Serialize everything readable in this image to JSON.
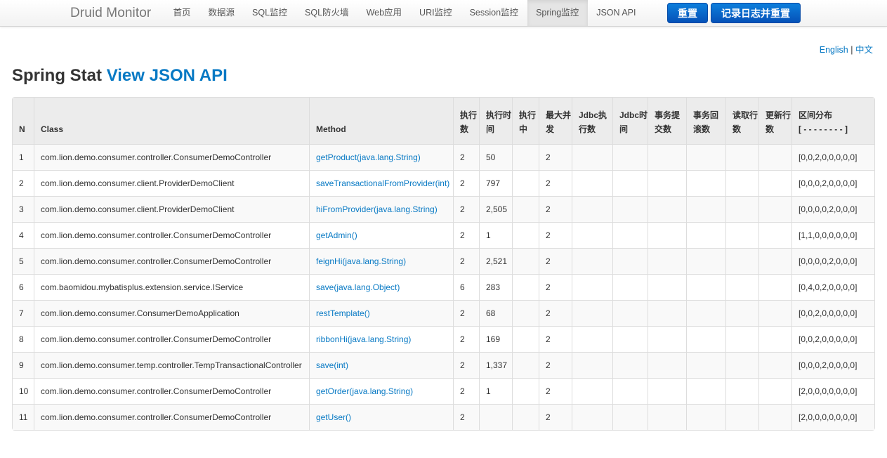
{
  "brand": "Druid Monitor",
  "nav": [
    "首页",
    "数据源",
    "SQL监控",
    "SQL防火墙",
    "Web应用",
    "URI监控",
    "Session监控",
    "Spring监控",
    "JSON API"
  ],
  "nav_active": 7,
  "buttons": {
    "reset": "重置",
    "log_reset": "记录日志并重置"
  },
  "lang": {
    "english": "English",
    "separator": "|",
    "chinese": "中文"
  },
  "title": {
    "prefix": "Spring Stat",
    "link": "View JSON API"
  },
  "table": {
    "headers": {
      "n": "N",
      "cls": "Class",
      "method": "Method",
      "exec_count": "执行数",
      "exec_time": "执行时间",
      "running": "执行中",
      "max_concurrent": "最大并发",
      "jdbc_exec": "Jdbc执行数",
      "jdbc_time": "Jdbc时间",
      "tx_commit": "事务提交数",
      "tx_rollback": "事务回滚数",
      "fetch_rows": "读取行数",
      "update_rows": "更新行数",
      "histogram": "区间分布",
      "histogram_sub": "[ - - - - - - - - ]"
    },
    "rows": [
      {
        "n": "1",
        "cls": "com.lion.demo.consumer.controller.ConsumerDemoController",
        "method": "getProduct(java.lang.String)",
        "exec_count": "2",
        "exec_time": "50",
        "running": "",
        "max_concurrent": "2",
        "jdbc_exec": "",
        "jdbc_time": "",
        "tx_commit": "",
        "tx_rollback": "",
        "fetch_rows": "",
        "update_rows": "",
        "histogram": "[0,0,2,0,0,0,0,0]"
      },
      {
        "n": "2",
        "cls": "com.lion.demo.consumer.client.ProviderDemoClient",
        "method": "saveTransactionalFromProvider(int)",
        "exec_count": "2",
        "exec_time": "797",
        "running": "",
        "max_concurrent": "2",
        "jdbc_exec": "",
        "jdbc_time": "",
        "tx_commit": "",
        "tx_rollback": "",
        "fetch_rows": "",
        "update_rows": "",
        "histogram": "[0,0,0,2,0,0,0,0]"
      },
      {
        "n": "3",
        "cls": "com.lion.demo.consumer.client.ProviderDemoClient",
        "method": "hiFromProvider(java.lang.String)",
        "exec_count": "2",
        "exec_time": "2,505",
        "running": "",
        "max_concurrent": "2",
        "jdbc_exec": "",
        "jdbc_time": "",
        "tx_commit": "",
        "tx_rollback": "",
        "fetch_rows": "",
        "update_rows": "",
        "histogram": "[0,0,0,0,2,0,0,0]"
      },
      {
        "n": "4",
        "cls": "com.lion.demo.consumer.controller.ConsumerDemoController",
        "method": "getAdmin()",
        "exec_count": "2",
        "exec_time": "1",
        "running": "",
        "max_concurrent": "2",
        "jdbc_exec": "",
        "jdbc_time": "",
        "tx_commit": "",
        "tx_rollback": "",
        "fetch_rows": "",
        "update_rows": "",
        "histogram": "[1,1,0,0,0,0,0,0]"
      },
      {
        "n": "5",
        "cls": "com.lion.demo.consumer.controller.ConsumerDemoController",
        "method": "feignHi(java.lang.String)",
        "exec_count": "2",
        "exec_time": "2,521",
        "running": "",
        "max_concurrent": "2",
        "jdbc_exec": "",
        "jdbc_time": "",
        "tx_commit": "",
        "tx_rollback": "",
        "fetch_rows": "",
        "update_rows": "",
        "histogram": "[0,0,0,0,2,0,0,0]"
      },
      {
        "n": "6",
        "cls": "com.baomidou.mybatisplus.extension.service.IService",
        "method": "save(java.lang.Object)",
        "exec_count": "6",
        "exec_time": "283",
        "running": "",
        "max_concurrent": "2",
        "jdbc_exec": "",
        "jdbc_time": "",
        "tx_commit": "",
        "tx_rollback": "",
        "fetch_rows": "",
        "update_rows": "",
        "histogram": "[0,4,0,2,0,0,0,0]"
      },
      {
        "n": "7",
        "cls": "com.lion.demo.consumer.ConsumerDemoApplication",
        "method": "restTemplate()",
        "exec_count": "2",
        "exec_time": "68",
        "running": "",
        "max_concurrent": "2",
        "jdbc_exec": "",
        "jdbc_time": "",
        "tx_commit": "",
        "tx_rollback": "",
        "fetch_rows": "",
        "update_rows": "",
        "histogram": "[0,0,2,0,0,0,0,0]"
      },
      {
        "n": "8",
        "cls": "com.lion.demo.consumer.controller.ConsumerDemoController",
        "method": "ribbonHi(java.lang.String)",
        "exec_count": "2",
        "exec_time": "169",
        "running": "",
        "max_concurrent": "2",
        "jdbc_exec": "",
        "jdbc_time": "",
        "tx_commit": "",
        "tx_rollback": "",
        "fetch_rows": "",
        "update_rows": "",
        "histogram": "[0,0,2,0,0,0,0,0]"
      },
      {
        "n": "9",
        "cls": "com.lion.demo.consumer.temp.controller.TempTransactionalController",
        "method": "save(int)",
        "exec_count": "2",
        "exec_time": "1,337",
        "running": "",
        "max_concurrent": "2",
        "jdbc_exec": "",
        "jdbc_time": "",
        "tx_commit": "",
        "tx_rollback": "",
        "fetch_rows": "",
        "update_rows": "",
        "histogram": "[0,0,0,2,0,0,0,0]"
      },
      {
        "n": "10",
        "cls": "com.lion.demo.consumer.controller.ConsumerDemoController",
        "method": "getOrder(java.lang.String)",
        "exec_count": "2",
        "exec_time": "1",
        "running": "",
        "max_concurrent": "2",
        "jdbc_exec": "",
        "jdbc_time": "",
        "tx_commit": "",
        "tx_rollback": "",
        "fetch_rows": "",
        "update_rows": "",
        "histogram": "[2,0,0,0,0,0,0,0]"
      },
      {
        "n": "11",
        "cls": "com.lion.demo.consumer.controller.ConsumerDemoController",
        "method": "getUser()",
        "exec_count": "2",
        "exec_time": "",
        "running": "",
        "max_concurrent": "2",
        "jdbc_exec": "",
        "jdbc_time": "",
        "tx_commit": "",
        "tx_rollback": "",
        "fetch_rows": "",
        "update_rows": "",
        "histogram": "[2,0,0,0,0,0,0,0]"
      }
    ]
  }
}
